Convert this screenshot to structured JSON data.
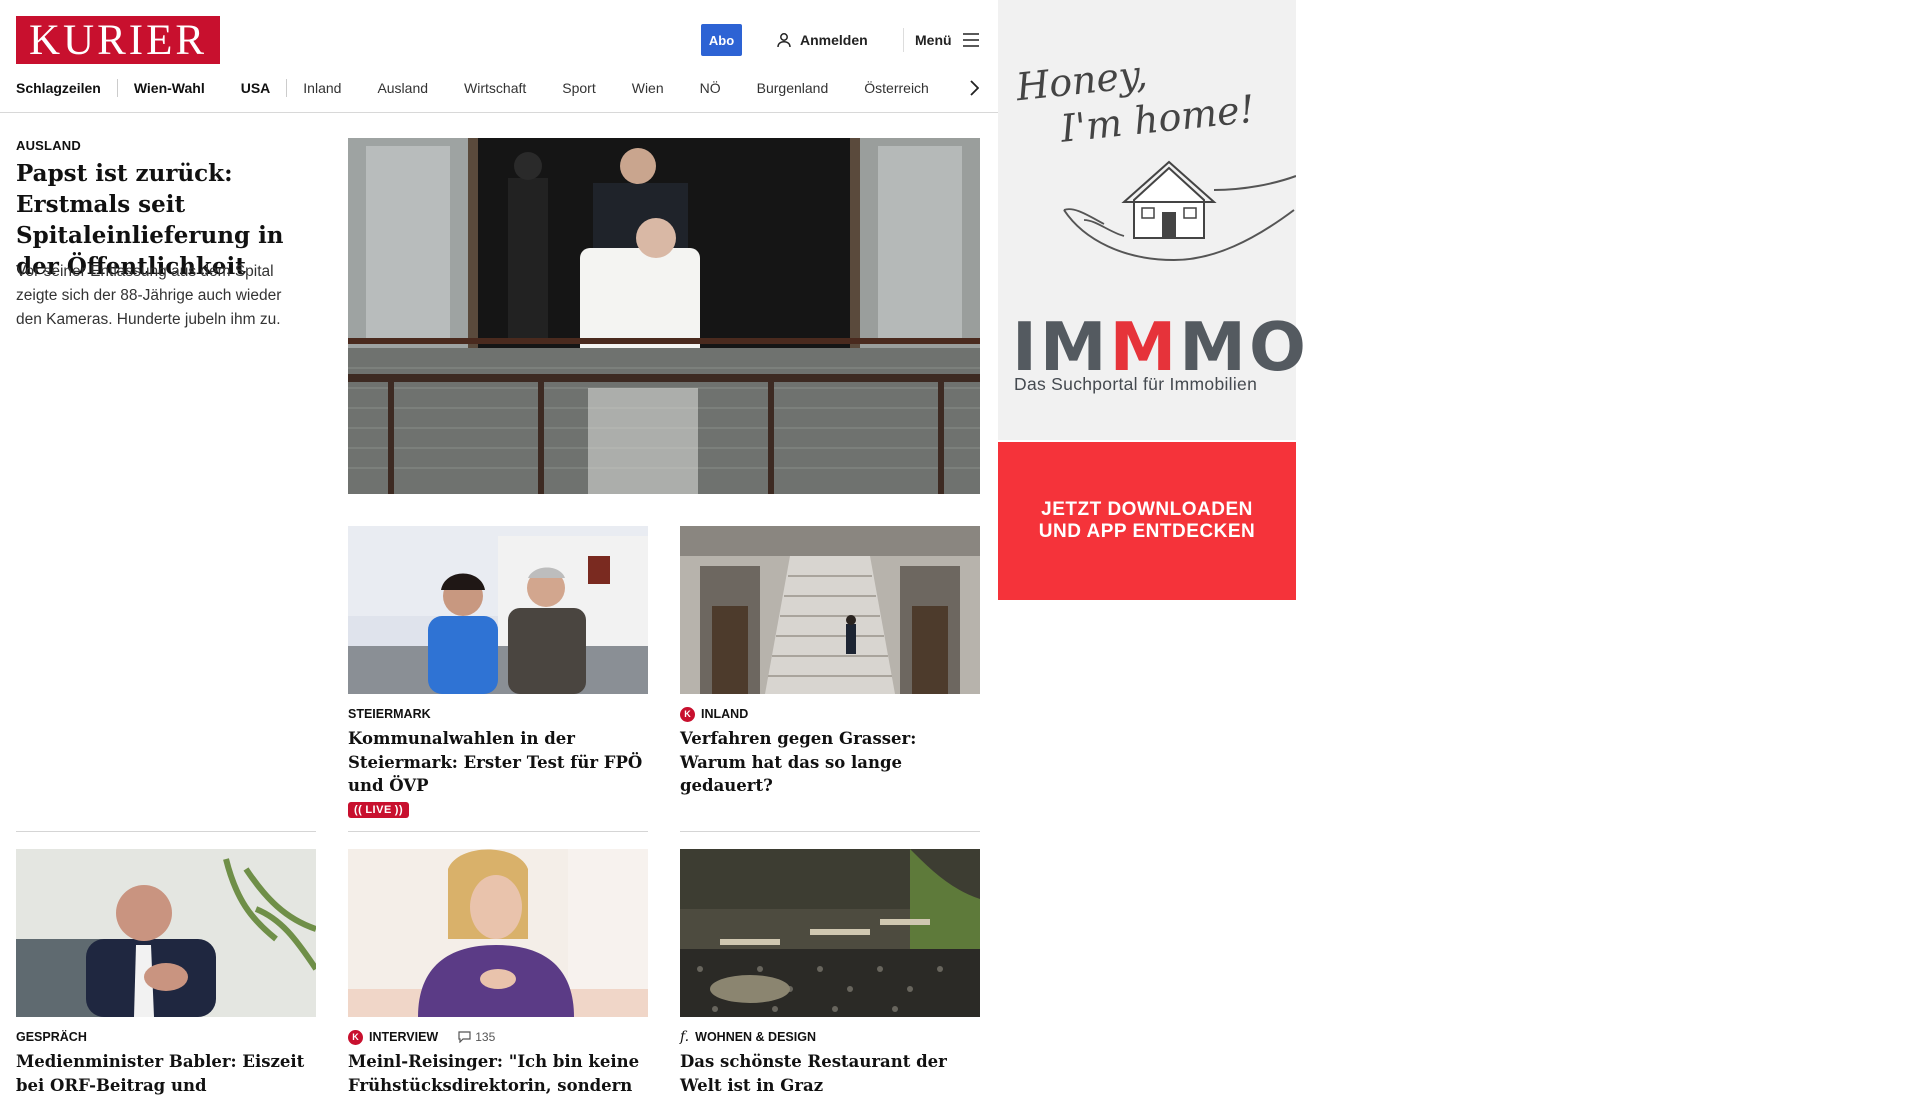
{
  "header": {
    "logo": "KURIER",
    "abo": "Abo",
    "login": "Anmelden",
    "menu": "Menü"
  },
  "nav": {
    "items": [
      "Schlagzeilen",
      "Wien-Wahl",
      "USA",
      "Inland",
      "Ausland",
      "Wirtschaft",
      "Sport",
      "Wien",
      "NÖ",
      "Burgenland",
      "Österreich"
    ]
  },
  "lead": {
    "category": "AUSLAND",
    "title": "Papst ist zurück: Erstmals seit Spitaleinlieferung in der Öffentlichkeit",
    "teaser": "Vor seiner Entlassung aus dem Spital zeigte sich der 88-Jährige auch wieder den Kameras. Hunderte jubeln ihm zu."
  },
  "cards": [
    {
      "category": "STEIERMARK",
      "title": "Kommunalwahlen in der Steiermark: Erster Test für FPÖ und ÖVP",
      "badge": "LIVE"
    },
    {
      "category": "INLAND",
      "title": "Verfahren gegen Grasser: Warum hat das so lange gedauert?"
    },
    {
      "category": "GESPRÄCH",
      "title": "Medienminister Babler: Eiszeit bei ORF-Beitrag und"
    },
    {
      "category": "INTERVIEW",
      "comments": "135",
      "title": "Meinl-Reisinger: \"Ich bin keine Frühstücksdirektorin, sondern"
    },
    {
      "category": "WOHNEN & DESIGN",
      "title": "Das schönste Restaurant der Welt ist in Graz"
    }
  ],
  "ad": {
    "script_line1": "Honey,",
    "script_line2": "I'm home!",
    "brand_a": "IM",
    "brand_m": "M",
    "brand_b": "MO",
    "subtitle": "Das Suchportal für Immobilien",
    "cta_line1": "JETZT DOWNLOADEN",
    "cta_line2": "UND APP ENTDECKEN"
  },
  "colors": {
    "brand": "#c8102e",
    "abo": "#2d63d4",
    "ad_red": "#f5333a"
  }
}
